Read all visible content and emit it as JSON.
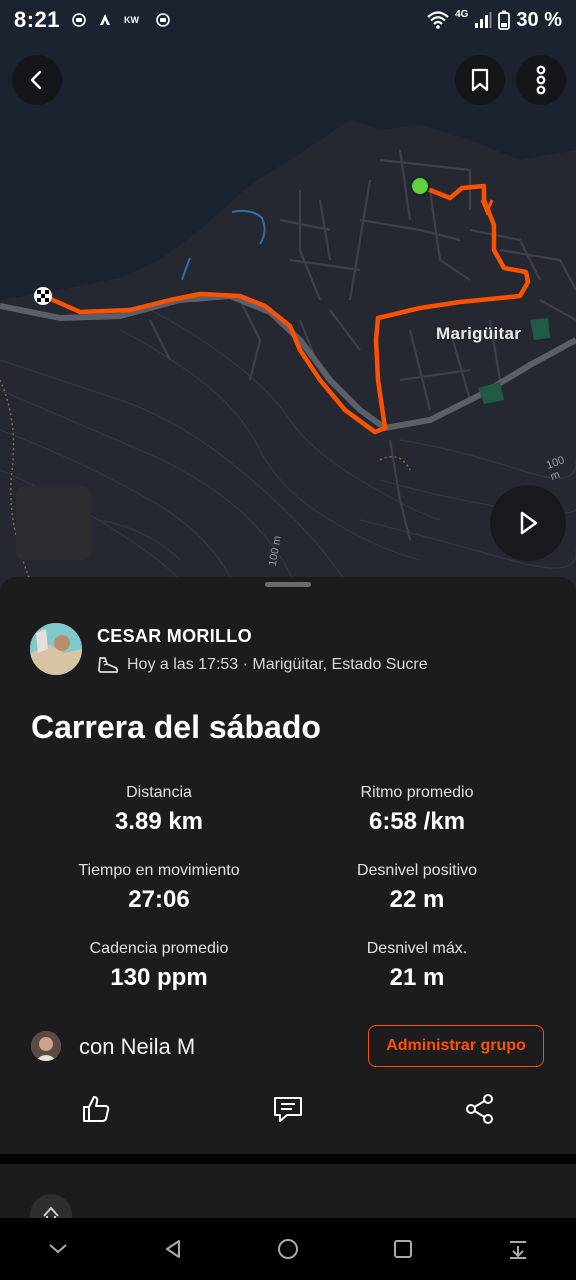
{
  "status_bar": {
    "time": "8:21",
    "network": "4G",
    "battery": "30 %"
  },
  "map": {
    "place_label": "Marigüitar",
    "contour_label_1": "100 m",
    "contour_label_2": "100 m",
    "route_color": "#fc5200",
    "start_color": "#5fd23c"
  },
  "header": {
    "back_icon": "back-arrow-icon",
    "bookmark_icon": "bookmark-icon",
    "more_icon": "more-vertical-icon"
  },
  "activity": {
    "athlete_name": "CESAR MORILLO",
    "meta": "Hoy a las 17:53 · Marigüitar, Estado Sucre",
    "title": "Carrera del sábado",
    "stats": [
      {
        "label": "Distancia",
        "value": "3.89 km"
      },
      {
        "label": "Ritmo promedio",
        "value": "6:58 /km"
      },
      {
        "label": "Tiempo en movimiento",
        "value": "27:06"
      },
      {
        "label": "Desnivel positivo",
        "value": "22 m"
      },
      {
        "label": "Cadencia promedio",
        "value": "130 ppm"
      },
      {
        "label": "Desnivel máx.",
        "value": "21 m"
      }
    ],
    "group_text": "con Neila M",
    "manage_group_label": "Administrar grupo",
    "accent": "#fc5200"
  }
}
